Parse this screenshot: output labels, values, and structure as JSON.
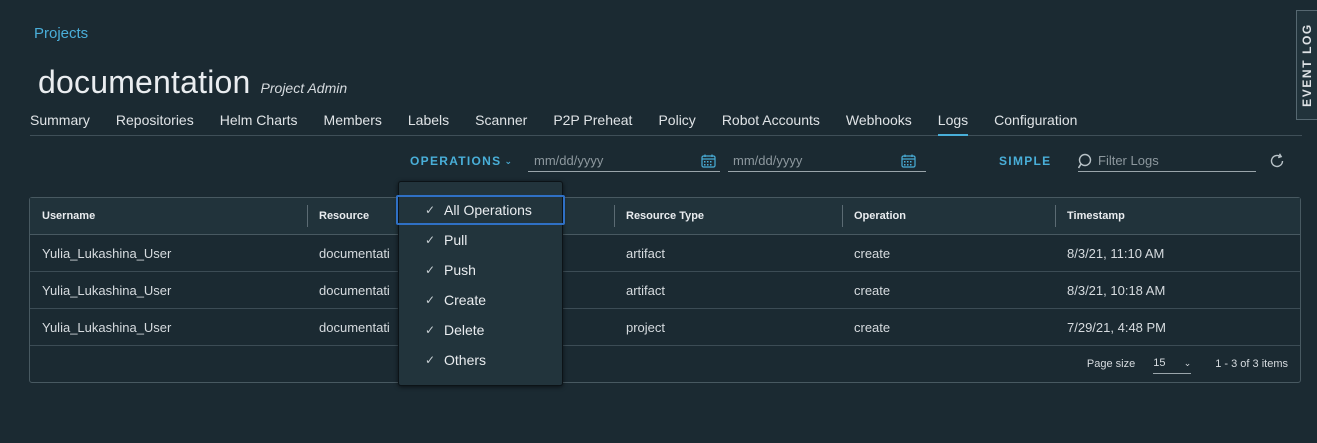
{
  "breadcrumb": "Projects",
  "project": {
    "name": "documentation",
    "role": "Project Admin"
  },
  "tabs": [
    {
      "label": "Summary",
      "active": false
    },
    {
      "label": "Repositories",
      "active": false
    },
    {
      "label": "Helm Charts",
      "active": false
    },
    {
      "label": "Members",
      "active": false
    },
    {
      "label": "Labels",
      "active": false
    },
    {
      "label": "Scanner",
      "active": false
    },
    {
      "label": "P2P Preheat",
      "active": false
    },
    {
      "label": "Policy",
      "active": false
    },
    {
      "label": "Robot Accounts",
      "active": false
    },
    {
      "label": "Webhooks",
      "active": false
    },
    {
      "label": "Logs",
      "active": true
    },
    {
      "label": "Configuration",
      "active": false
    }
  ],
  "event_log": "EVENT LOG",
  "toolbar": {
    "operations_label": "OPERATIONS",
    "start_date_placeholder": "mm/dd/yyyy",
    "end_date_placeholder": "mm/dd/yyyy",
    "simple_label": "SIMPLE",
    "filter_placeholder": "Filter Logs"
  },
  "operations_menu": [
    {
      "label": "All Operations",
      "checked": true,
      "focused": true
    },
    {
      "label": "Pull",
      "checked": true
    },
    {
      "label": "Push",
      "checked": true
    },
    {
      "label": "Create",
      "checked": true
    },
    {
      "label": "Delete",
      "checked": true
    },
    {
      "label": "Others",
      "checked": true
    }
  ],
  "table": {
    "columns": [
      "Username",
      "Resource",
      "Resource Type",
      "Operation",
      "Timestamp"
    ],
    "rows": [
      [
        "Yulia_Lukashina_User",
        "documentati",
        "artifact",
        "create",
        "8/3/21, 11:10 AM"
      ],
      [
        "Yulia_Lukashina_User",
        "documentati",
        "artifact",
        "create",
        "8/3/21, 10:18 AM"
      ],
      [
        "Yulia_Lukashina_User",
        "documentati",
        "project",
        "create",
        "7/29/21, 4:48 PM"
      ]
    ]
  },
  "footer": {
    "page_size_label": "Page size",
    "page_size_value": "15",
    "range_text": "1 - 3 of 3 items"
  },
  "colors": {
    "background": "#1b2a32",
    "accent": "#49afd9",
    "focus": "#2f70c5"
  }
}
